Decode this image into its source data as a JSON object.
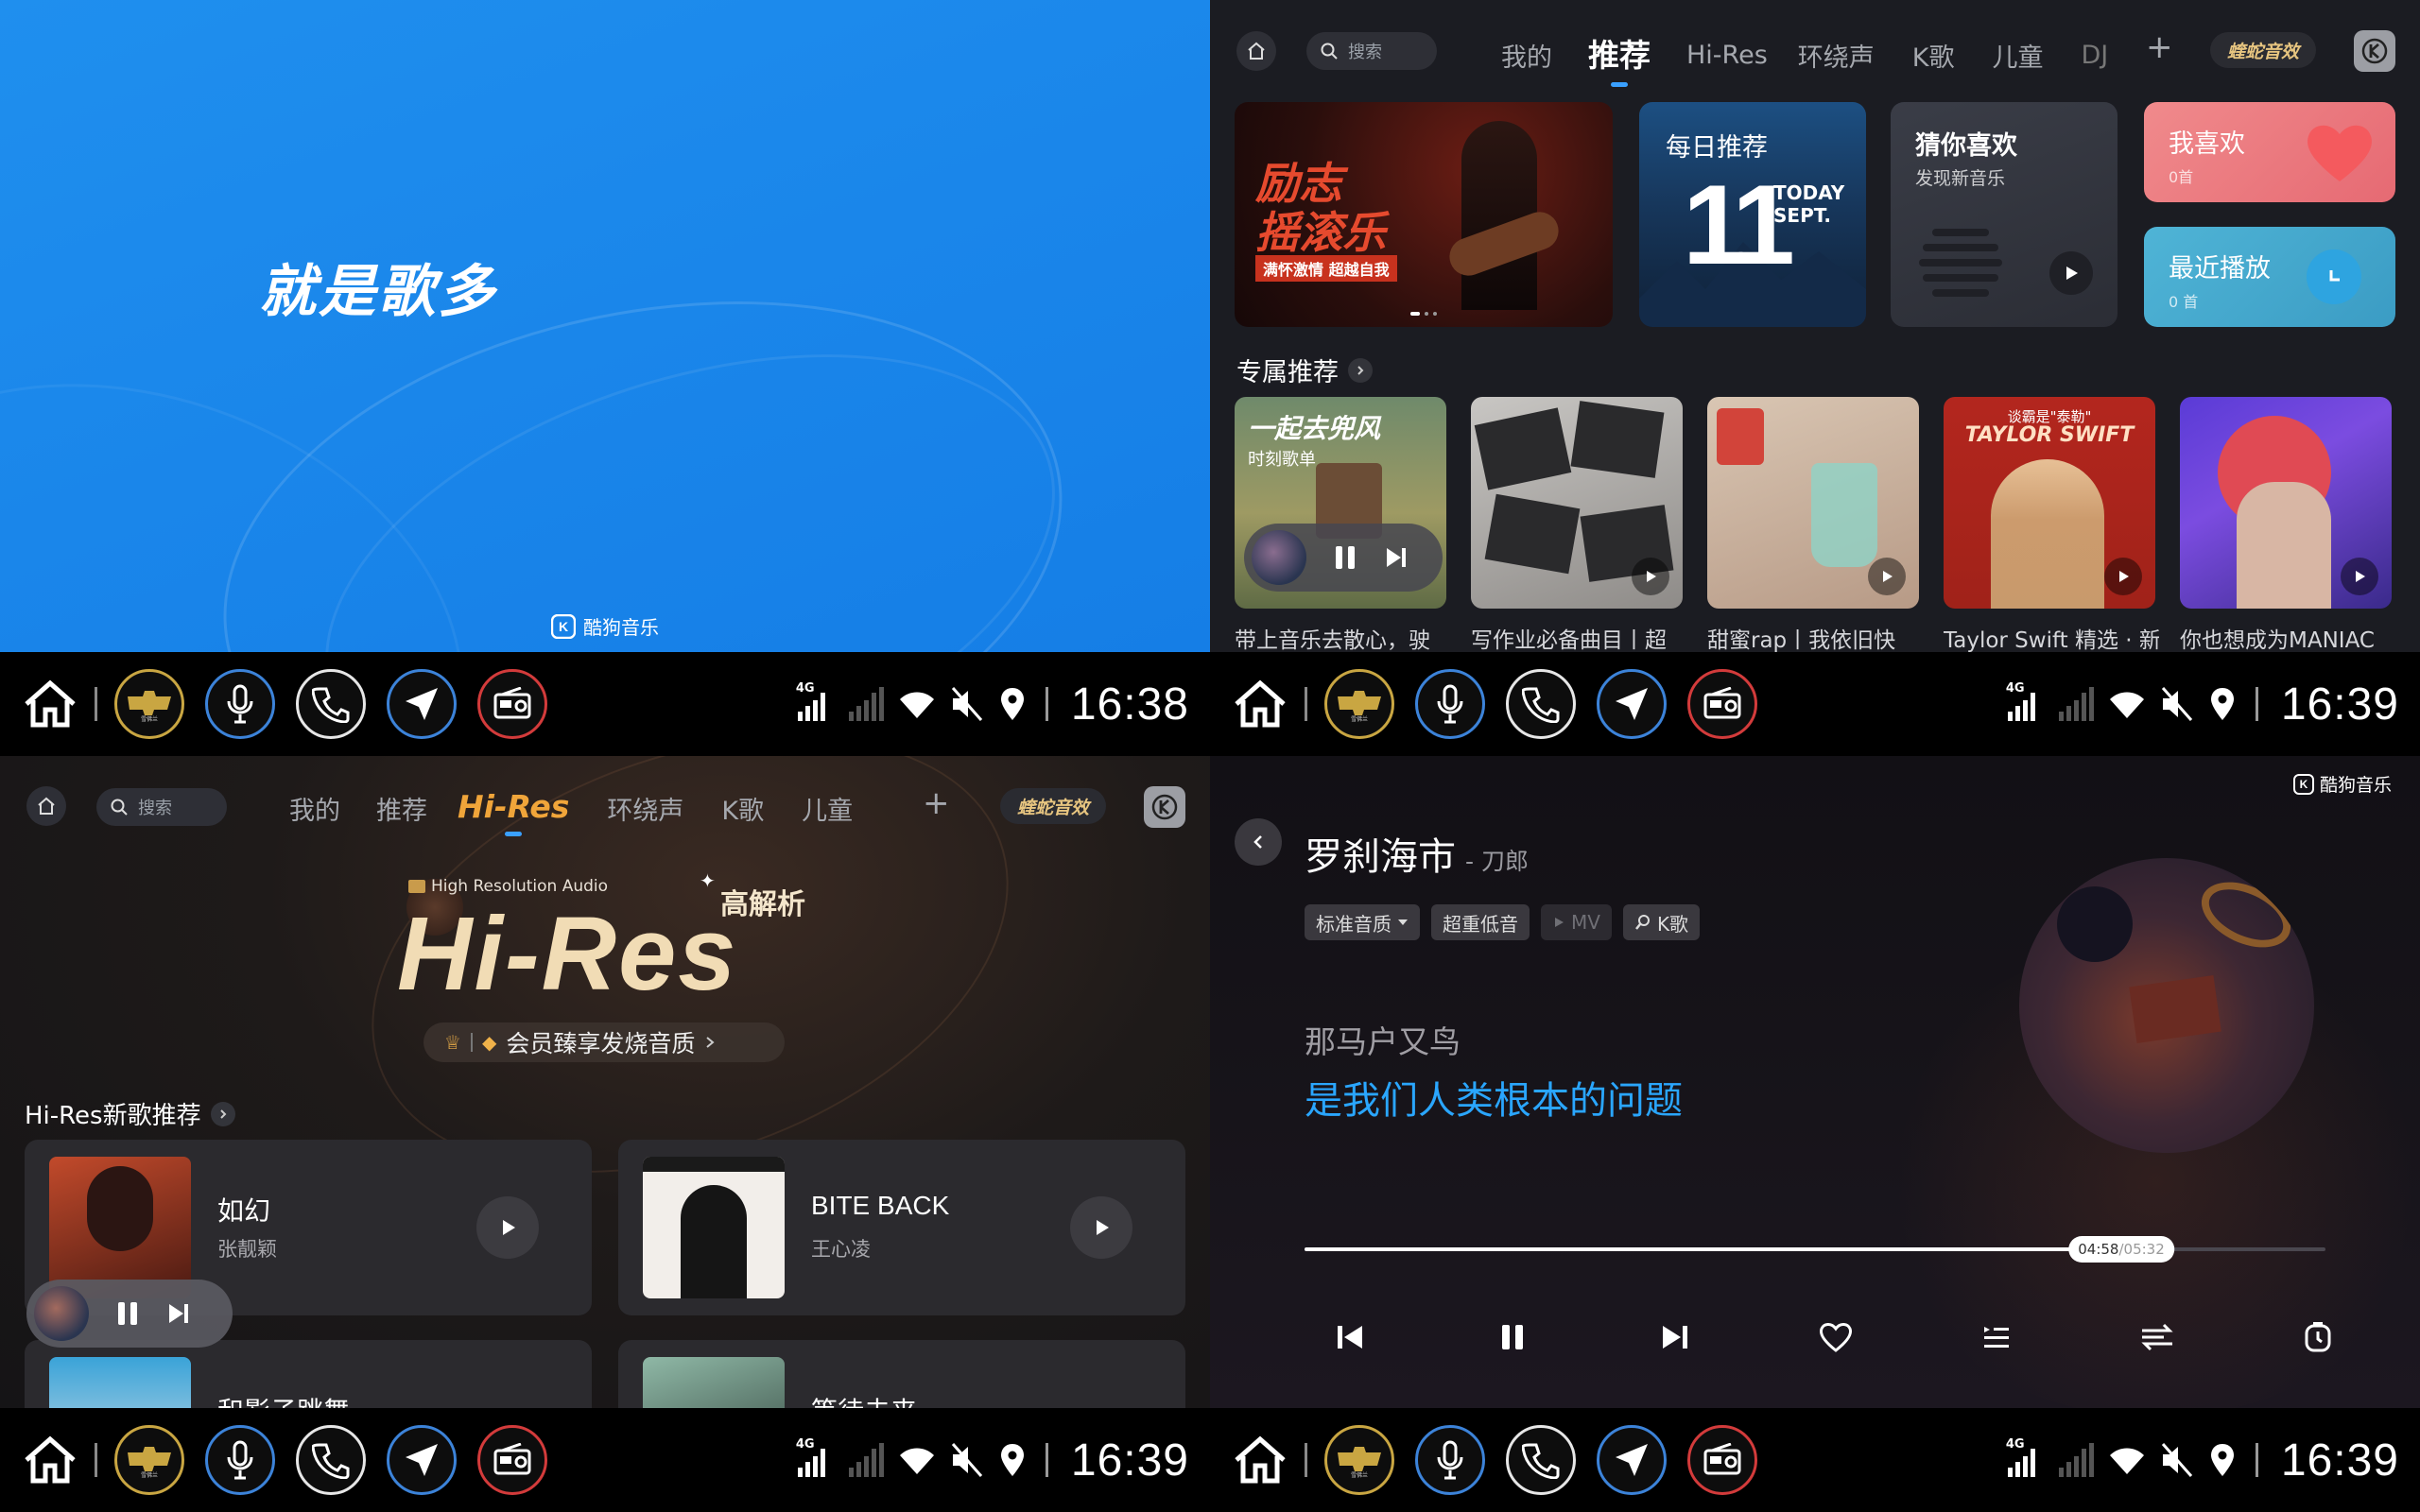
{
  "splash": {
    "slogan": "就是歌多",
    "brand": "酷狗音乐"
  },
  "dock": {
    "time_1": "16:38",
    "time_2": "16:39",
    "time_3": "16:39",
    "time_4": "16:39",
    "network": "4G",
    "chevy_badge": "MyChevy",
    "chevy_cn": "雪佛兰"
  },
  "browse": {
    "search_placeholder": "搜索",
    "tabs": [
      "我的",
      "推荐",
      "Hi-Res",
      "环绕声",
      "K歌",
      "儿童",
      "DJ"
    ],
    "active_tab": "推荐",
    "viper": "蝰蛇音效",
    "banner": {
      "title_1": "励志",
      "title_2": "摇滚乐",
      "tagline": "满怀激情 超越自我"
    },
    "daily": {
      "title": "每日推荐",
      "day": "11",
      "today": "TODAY",
      "month": "SEPT."
    },
    "guess": {
      "title": "猜你喜欢",
      "sub": "发现新音乐"
    },
    "favorites": {
      "title": "我喜欢",
      "count": "0首"
    },
    "recent": {
      "title": "最近播放",
      "count": "0 首"
    },
    "section_title": "专属推荐",
    "playlists": [
      {
        "caption": "带上音乐去散心，驶",
        "cover_title": "一起去兜风",
        "cover_sub": "时刻歌单"
      },
      {
        "caption": "写作业必备曲目丨超"
      },
      {
        "caption": "甜蜜rap丨我依旧快"
      },
      {
        "caption": "Taylor Swift 精选 · 新",
        "cover_top": "谈霸是\"泰勒\"",
        "cover_title": "TAYLOR SWIFT"
      },
      {
        "caption": "你也想成为MANIAC"
      }
    ]
  },
  "hires": {
    "search_placeholder": "搜索",
    "tabs": [
      "我的",
      "推荐",
      "Hi-Res",
      "环绕声",
      "K歌",
      "儿童"
    ],
    "active_tab": "Hi-Res",
    "viper": "蝰蛇音效",
    "badge_small": "High  Resolution  Audio",
    "badge_big": "Hi-Res",
    "badge_cn": "高解析",
    "vip_text": "会员臻享发烧音质",
    "section_title": "Hi-Res新歌推荐",
    "songs": [
      {
        "name": "如幻",
        "artist": "张靓颖"
      },
      {
        "name": "BITE BACK",
        "artist": "王心凌"
      },
      {
        "name": "和影子跳舞",
        "artist": ""
      },
      {
        "name": "等待未来",
        "artist": ""
      }
    ]
  },
  "player": {
    "brand": "酷狗音乐",
    "title": "罗刹海市",
    "artist": "- 刀郎",
    "tags": [
      "标准音质",
      "超重低音",
      "MV",
      "K歌"
    ],
    "lyric_prev": "那马户又鸟",
    "lyric_current": "是我们人类根本的问题",
    "time_current": "04:58",
    "time_total": "/05:32",
    "progress": 0.8,
    "accent": "#2aa6ff"
  }
}
